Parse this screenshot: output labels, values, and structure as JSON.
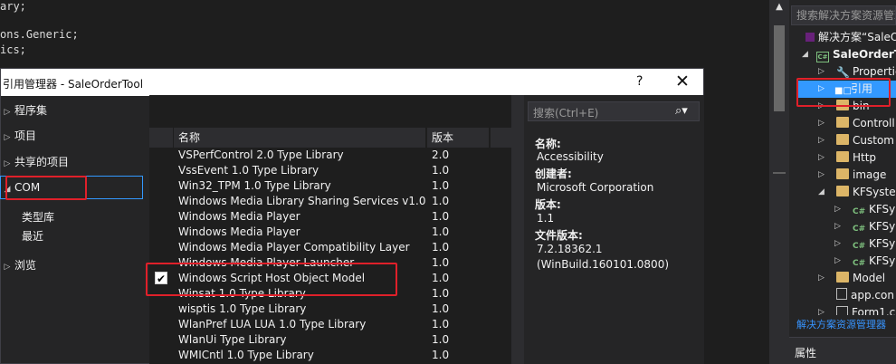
{
  "editor": {
    "lines": [
      "ary;",
      "ons.Generic;",
      "ics;"
    ]
  },
  "solution_explorer": {
    "search_placeholder": "搜索解决方案资源管理",
    "items": [
      {
        "label": "解决方案“SaleO"
      },
      {
        "label": "SaleOrderT"
      },
      {
        "label": "Propertie"
      },
      {
        "label": "引用"
      },
      {
        "label": "bin"
      },
      {
        "label": "Controll"
      },
      {
        "label": "Custom"
      },
      {
        "label": "Http"
      },
      {
        "label": "image"
      },
      {
        "label": "KFSyster"
      },
      {
        "label": "KFSy"
      },
      {
        "label": "KFSy"
      },
      {
        "label": "KFSy"
      },
      {
        "label": "KFSy"
      },
      {
        "label": "Model"
      },
      {
        "label": "app.con"
      },
      {
        "label": "Form1.c"
      }
    ],
    "footer_link": "解决方案资源管理器",
    "properties_label": "属性"
  },
  "dialog": {
    "title": "引用管理器 - SaleOrderTool",
    "help_label": "?",
    "close_label": "✕",
    "nav": {
      "assemblies": "程序集",
      "projects": "项目",
      "shared_projects": "共享的项目",
      "com": "COM",
      "type_libraries": "类型库",
      "recent": "最近",
      "browse": "浏览"
    },
    "columns": {
      "name": "名称",
      "version": "版本"
    },
    "rows": [
      {
        "name": "VSPerfControl 2.0 Type Library",
        "version": "2.0"
      },
      {
        "name": "VssEvent 1.0 Type Library",
        "version": "1.0"
      },
      {
        "name": "Win32_TPM 1.0 Type Library",
        "version": "1.0"
      },
      {
        "name": "Windows Media Library Sharing Services v1.0",
        "version": "1.0"
      },
      {
        "name": "Windows Media Player",
        "version": "1.0"
      },
      {
        "name": "Windows Media Player",
        "version": "1.0"
      },
      {
        "name": "Windows Media Player Compatibility Layer",
        "version": "1.0"
      },
      {
        "name": "Windows Media Player Launcher",
        "version": "1.0"
      },
      {
        "name": "Windows Script Host Object Model",
        "version": "1.0",
        "checked": true
      },
      {
        "name": "Winsat 1.0 Type Library",
        "version": "1.0"
      },
      {
        "name": "wisptis 1.0 Type Library",
        "version": "1.0"
      },
      {
        "name": "WlanPref LUA LUA 1.0 Type Library",
        "version": "1.0"
      },
      {
        "name": "WlanUi Type Library",
        "version": "1.0"
      },
      {
        "name": "WMICntl 1.0 Type Library",
        "version": "1.0"
      }
    ],
    "search_placeholder": "搜索(Ctrl+E)",
    "details": {
      "name_label": "名称:",
      "name_value": "Accessibility",
      "creator_label": "创建者:",
      "creator_value": "Microsoft Corporation",
      "version_label": "版本:",
      "version_value": "1.1",
      "file_version_label": "文件版本:",
      "file_version_value": "7.2.18362.1",
      "file_version_build": "(WinBuild.160101.0800)"
    }
  },
  "colors": {
    "highlight_box": "#e0202a",
    "selection": "#3399ff",
    "selected_tree_bg": "#3399ff"
  }
}
